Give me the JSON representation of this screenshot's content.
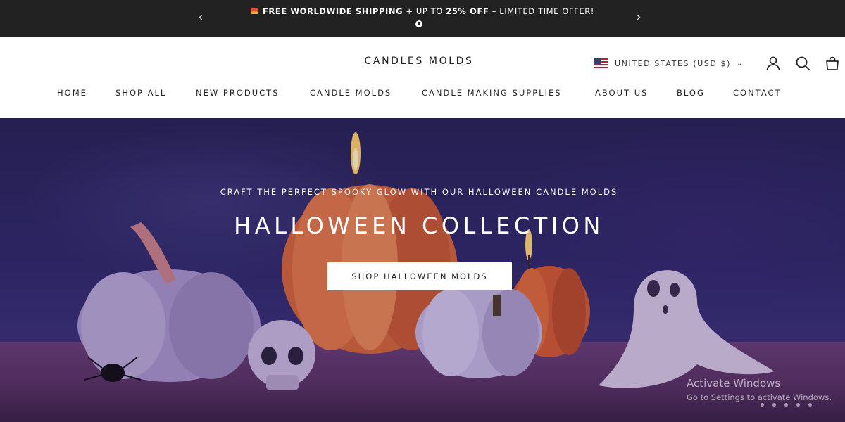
{
  "announcement": {
    "prev_icon": "chevron-left-icon",
    "next_icon": "chevron-right-icon",
    "bold_1": "FREE WORLDWIDE SHIPPING",
    "light_1": " + UP TO ",
    "bold_2": "25% OFF",
    "light_2": " – LIMITED TIME OFFER!",
    "clock_icon": "clock-icon"
  },
  "header": {
    "logo": "CANDLES MOLDS",
    "locale": "UNITED STATES (USD $)",
    "icons": [
      "account-icon",
      "search-icon",
      "cart-icon"
    ]
  },
  "nav": {
    "items": [
      "HOME",
      "SHOP ALL",
      "NEW PRODUCTS",
      "CANDLE MOLDS",
      "CANDLE MAKING SUPPLIES",
      "ABOUT US",
      "BLOG",
      "CONTACT"
    ]
  },
  "hero": {
    "subtitle": "CRAFT THE PERFECT SPOOKY GLOW WITH OUR HALLOWEEN CANDLE MOLDS",
    "title": "HALLOWEEN COLLECTION",
    "cta": "SHOP HALLOWEEN MOLDS"
  },
  "watermark": {
    "line1": "Activate Windows",
    "line2": "Go to Settings to activate Windows."
  },
  "colors": {
    "announce_bg": "#222222",
    "header_bg": "#ffffff",
    "hero_bg": "#30296a",
    "pumpkin": "#e36b3c"
  }
}
